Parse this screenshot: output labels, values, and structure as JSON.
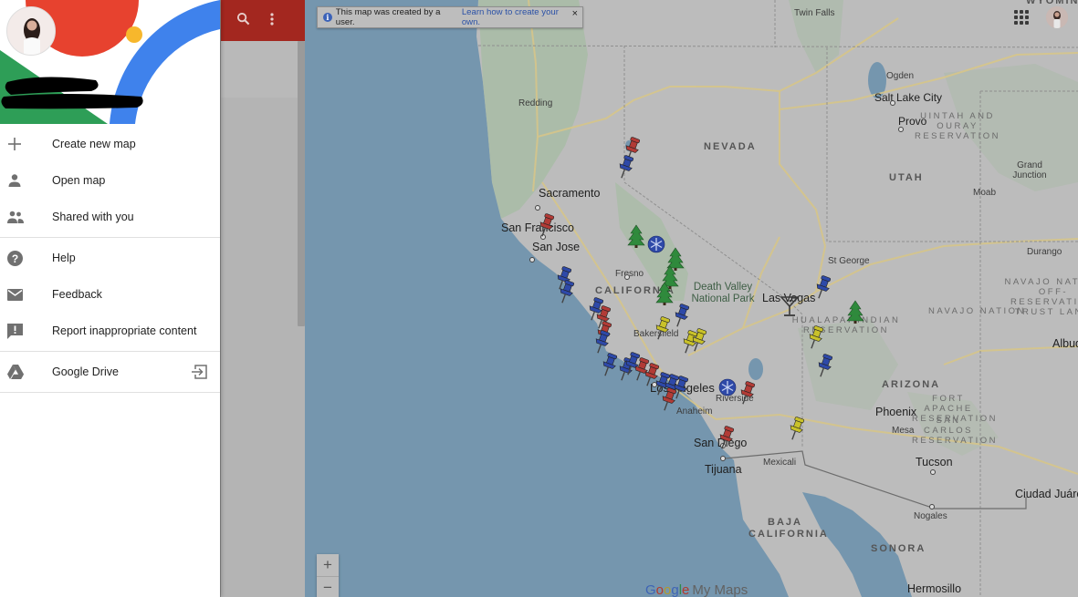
{
  "drawer": {
    "user_name_redacted": true,
    "menu_groups": [
      [
        {
          "icon": "plus-icon",
          "label": "Create new map"
        },
        {
          "icon": "person-icon",
          "label": "Open map"
        },
        {
          "icon": "people-icon",
          "label": "Shared with you"
        }
      ],
      [
        {
          "icon": "help-icon",
          "label": "Help"
        },
        {
          "icon": "mail-icon",
          "label": "Feedback"
        },
        {
          "icon": "report-icon",
          "label": "Report inappropriate content"
        }
      ],
      [
        {
          "icon": "google-drive-icon",
          "label": "Google Drive",
          "trailing_icon": "open-in-icon"
        }
      ]
    ]
  },
  "legend_panel": {
    "header_color": "#a3271f",
    "icons": [
      "search-icon",
      "more-vert-icon"
    ]
  },
  "banner": {
    "icon": "info-icon",
    "text": "This map was created by a user.",
    "link": "Learn how to create your own.",
    "close": "×"
  },
  "top_right": {
    "apps_icon": "apps-grid-icon",
    "avatar": "account-avatar"
  },
  "zoom_controls": {
    "in": "+",
    "out": "−"
  },
  "logo": {
    "google": [
      "G",
      "o",
      "o",
      "g",
      "l",
      "e"
    ],
    "product": "My Maps"
  },
  "map": {
    "cities": [
      {
        "name": "Twin Falls",
        "cls": "small"
      },
      {
        "name": "Redding",
        "cls": "small"
      },
      {
        "name": "Ogden",
        "cls": "small"
      },
      {
        "name": "Salt Lake City",
        "cls": ""
      },
      {
        "name": "Provo",
        "cls": ""
      },
      {
        "name": "Grand Junction",
        "cls": "small"
      },
      {
        "name": "Moab",
        "cls": "small"
      },
      {
        "name": "Sacramento",
        "cls": "big"
      },
      {
        "name": "San Francisco",
        "cls": "big"
      },
      {
        "name": "San Jose",
        "cls": "big"
      },
      {
        "name": "Fresno",
        "cls": "small"
      },
      {
        "name": "Bakersfield",
        "cls": "small"
      },
      {
        "name": "Las Vegas",
        "cls": "big"
      },
      {
        "name": "St George",
        "cls": "small"
      },
      {
        "name": "Durango",
        "cls": "small"
      },
      {
        "name": "Los Angeles",
        "cls": "big"
      },
      {
        "name": "Riverside",
        "cls": "small"
      },
      {
        "name": "Anaheim",
        "cls": "small"
      },
      {
        "name": "San Diego",
        "cls": "big"
      },
      {
        "name": "Tijuana",
        "cls": "big"
      },
      {
        "name": "Mexicali",
        "cls": "small"
      },
      {
        "name": "Phoenix",
        "cls": "big"
      },
      {
        "name": "Mesa",
        "cls": "small"
      },
      {
        "name": "Tucson",
        "cls": "big"
      },
      {
        "name": "Nogales",
        "cls": "small"
      },
      {
        "name": "Ciudad Juárez",
        "cls": "big"
      },
      {
        "name": "Albuquerque",
        "cls": "big"
      },
      {
        "name": "Hermosillo",
        "cls": "big"
      }
    ],
    "states": [
      "NEVADA",
      "UTAH",
      "CALIFORNIA",
      "ARIZONA",
      "BAJA CALIFORNIA",
      "SONORA",
      "WYOMING"
    ],
    "reservations": [
      "UINTAH AND OURAY RESERVATION",
      "NAVAJO NATION OFF-RESERVATION TRUST LAND",
      "NAVAJO NATION",
      "HUALAPAI INDIAN RESERVATION",
      "FORT APACHE RESERVATION",
      "SAN CARLOS RESERVATION"
    ],
    "parks": [
      "Death Valley National Park"
    ],
    "marker_colors": {
      "red": "#b23b36",
      "blue": "#2e49a8",
      "yellow": "#c9c22a",
      "green": "#2f8a3c",
      "snow": "#2e49a8",
      "cocktail": "#3a3a3a"
    },
    "markers": [
      {
        "type": "pin",
        "color": "red"
      },
      {
        "type": "pin",
        "color": "blue"
      },
      {
        "type": "pin",
        "color": "red"
      },
      {
        "type": "tree",
        "color": "green"
      },
      {
        "type": "snowflake",
        "color": "snow"
      },
      {
        "type": "tree",
        "color": "green"
      },
      {
        "type": "tree",
        "color": "green"
      },
      {
        "type": "tree",
        "color": "green"
      },
      {
        "type": "pin",
        "color": "blue"
      },
      {
        "type": "pin",
        "color": "blue"
      },
      {
        "type": "pin",
        "color": "blue"
      },
      {
        "type": "pin",
        "color": "red"
      },
      {
        "type": "pin",
        "color": "red"
      },
      {
        "type": "pin",
        "color": "blue"
      },
      {
        "type": "pin",
        "color": "yellow"
      },
      {
        "type": "pin",
        "color": "blue"
      },
      {
        "type": "pin",
        "color": "yellow"
      },
      {
        "type": "pin",
        "color": "yellow"
      },
      {
        "type": "pin",
        "color": "blue"
      },
      {
        "type": "pin",
        "color": "blue"
      },
      {
        "type": "pin",
        "color": "blue"
      },
      {
        "type": "pin",
        "color": "red"
      },
      {
        "type": "pin",
        "color": "red"
      },
      {
        "type": "pin",
        "color": "blue"
      },
      {
        "type": "pin",
        "color": "blue"
      },
      {
        "type": "pin",
        "color": "red"
      },
      {
        "type": "pin",
        "color": "blue"
      },
      {
        "type": "snowflake",
        "color": "snow"
      },
      {
        "type": "pin",
        "color": "red"
      },
      {
        "type": "pin",
        "color": "red"
      },
      {
        "type": "pin",
        "color": "yellow"
      },
      {
        "type": "pin",
        "color": "blue"
      },
      {
        "type": "cocktail",
        "color": "cocktail"
      },
      {
        "type": "tree",
        "color": "green"
      },
      {
        "type": "pin",
        "color": "yellow"
      },
      {
        "type": "pin",
        "color": "blue"
      }
    ]
  }
}
